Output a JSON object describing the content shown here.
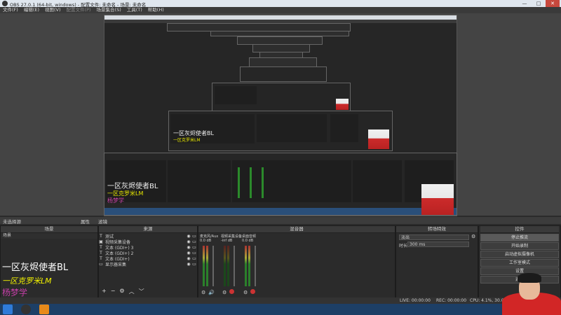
{
  "window": {
    "title": "OBS 27.0.1 (64-bit, windows) - 配置文件: 未命名 - 场景: 未命名",
    "controls": [
      "—",
      "□",
      "✕"
    ]
  },
  "menu": [
    "文件(F)",
    "编辑(E)",
    "视图(V)",
    "配置文件(P)",
    "场景集合(S)",
    "工具(T)",
    "帮助(H)"
  ],
  "scene_bar": {
    "label": "未选择源",
    "properties": "属性",
    "filters": "滤镜"
  },
  "docks": {
    "scenes": {
      "title": "场景",
      "items": [
        "场景"
      ]
    },
    "sources": {
      "title": "来源",
      "items": [
        {
          "icon": "T",
          "label": "测试"
        },
        {
          "icon": "cam",
          "label": "视频采集设备"
        },
        {
          "icon": "T",
          "label": "文本 (GDI+) 3"
        },
        {
          "icon": "T",
          "label": "文本 (GDI+) 2"
        },
        {
          "icon": "T",
          "label": "文本 (GDI+)"
        },
        {
          "icon": "monitor",
          "label": "显示器采集"
        }
      ]
    },
    "mixer": {
      "title": "混音器",
      "channels": [
        {
          "name": "麦克风/Aux",
          "db": "0.0 dB"
        },
        {
          "name": "视频采集设备",
          "db": "-inf dB"
        },
        {
          "name": "桌面音频",
          "db": "0.0 dB"
        }
      ]
    },
    "transitions": {
      "title": "转场特效",
      "type": "淡出",
      "duration_label": "时长",
      "duration": "300 ms"
    },
    "controls": {
      "title": "控件",
      "buttons": [
        "停止推流",
        "开始录制",
        "启动虚拟摄像机",
        "工作室模式",
        "设置",
        "退出"
      ]
    }
  },
  "overlay": {
    "line1": "一区灰烬使者BL",
    "line2": "一区克罗米LM",
    "line3": "杨梦学"
  },
  "status": {
    "live": "LIVE: 00:00:00",
    "rec": "REC: 00:00:00",
    "cpu": "CPU: 4.1%, 30.00 fps"
  }
}
